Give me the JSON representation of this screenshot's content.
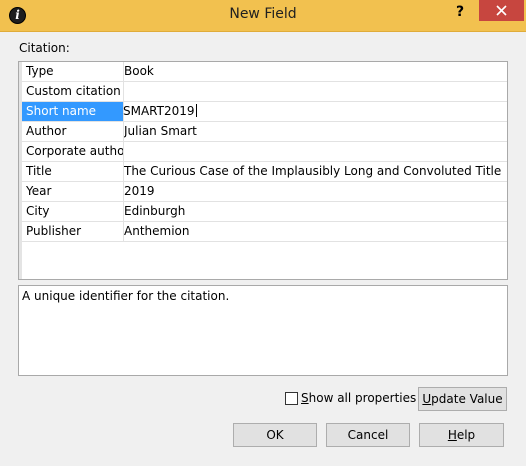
{
  "window": {
    "title": "New Field",
    "app_icon": "i",
    "help_glyph": "?"
  },
  "citation_label": "Citation:",
  "properties": [
    {
      "name": "Type",
      "value": "Book"
    },
    {
      "name": "Custom citation",
      "value": ""
    },
    {
      "name": "Short name",
      "value": "SMART2019",
      "selected": true,
      "editing": true
    },
    {
      "name": "Author",
      "value": "Julian Smart"
    },
    {
      "name": "Corporate author",
      "value": ""
    },
    {
      "name": "Title",
      "value": "The Curious Case of the Implausibly Long and Convoluted Title"
    },
    {
      "name": "Year",
      "value": "2019"
    },
    {
      "name": "City",
      "value": "Edinburgh"
    },
    {
      "name": "Publisher",
      "value": "Anthemion"
    }
  ],
  "description": "A unique identifier for the citation.",
  "show_all": {
    "label_mnemonic": "S",
    "label_rest": "how all properties",
    "checked": false
  },
  "buttons": {
    "update_mnemonic": "U",
    "update_rest": "pdate Value",
    "ok": "OK",
    "cancel": "Cancel",
    "help_mnemonic": "H",
    "help_rest": "elp"
  },
  "colors": {
    "titlebar": "#f2c14f",
    "close": "#c7463f",
    "selection": "#3399ff"
  }
}
